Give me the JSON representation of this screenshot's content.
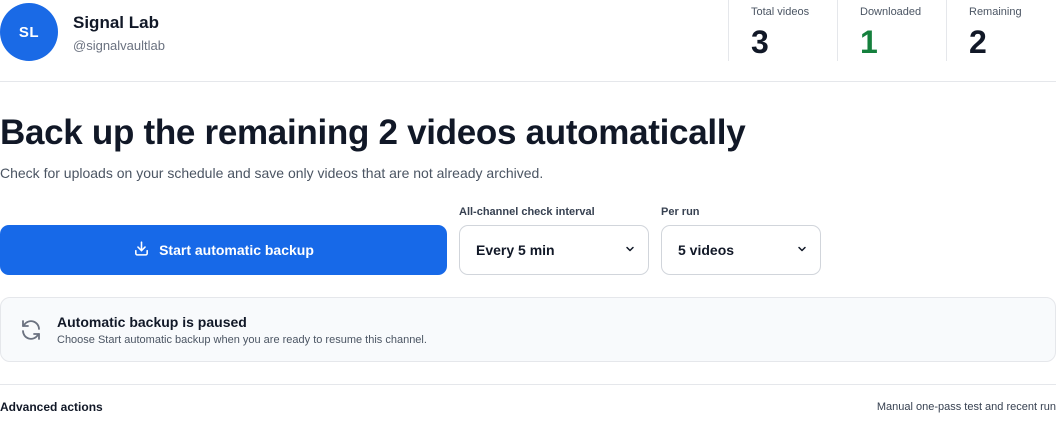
{
  "channel": {
    "initials": "SL",
    "name": "Signal Lab",
    "handle": "@signalvaultlab"
  },
  "stats": [
    {
      "label": "Total videos",
      "value": "3"
    },
    {
      "label": "Downloaded",
      "value": "1",
      "color": "#15803d"
    },
    {
      "label": "Remaining",
      "value": "2"
    }
  ],
  "hero": {
    "headline": "Back up the remaining 2 videos automatically",
    "subline": "Check for uploads on your schedule and save only videos that are not already archived."
  },
  "controls": {
    "start_label": "Start automatic backup",
    "interval_label": "All-channel check interval",
    "interval_value": "Every 5 min",
    "per_run_label": "Per run",
    "per_run_value": "5 videos"
  },
  "status": {
    "title": "Automatic backup is paused",
    "description": "Choose Start automatic backup when you are ready to resume this channel."
  },
  "advanced": {
    "title": "Advanced actions",
    "note": "Manual one-pass test and recent run"
  },
  "colors": {
    "accent": "#1769e8",
    "success": "#15803d"
  },
  "icons": {
    "start": "download-icon",
    "status": "refresh-icon",
    "dropdown": "chevron-down-icon"
  }
}
